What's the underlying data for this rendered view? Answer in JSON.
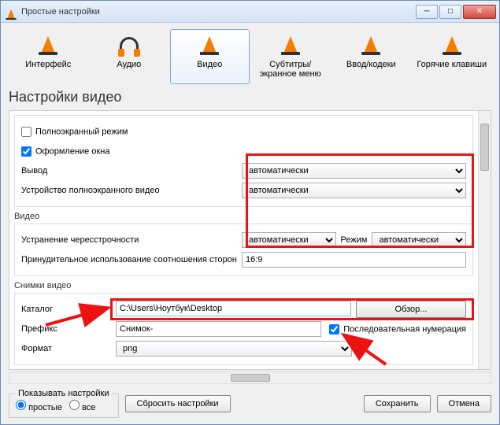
{
  "window": {
    "title": "Простые настройки"
  },
  "tabs": [
    {
      "label": "Интерфейс"
    },
    {
      "label": "Аудио"
    },
    {
      "label": "Видео"
    },
    {
      "label": "Субтитры/экранное меню"
    },
    {
      "label": "Ввод/кодеки"
    },
    {
      "label": "Горячие клавиши"
    }
  ],
  "heading": "Настройки видео",
  "general": {
    "fullscreen": {
      "label": "Полноэкранный режим",
      "checked": false
    },
    "decorations": {
      "label": "Оформление окна",
      "checked": true
    },
    "output": {
      "label": "Вывод",
      "value": "автоматически"
    },
    "fullscreen_device": {
      "label": "Устройство полноэкранного видео",
      "value": "автоматически"
    }
  },
  "video_section": {
    "title": "Видео",
    "deinterlace": {
      "label": "Устранение чересстрочности",
      "value": "автоматически"
    },
    "mode": {
      "label": "Режим",
      "value": "автоматически"
    },
    "aspect": {
      "label": "Принудительное использование соотношения сторон",
      "value": "16:9"
    }
  },
  "snapshots": {
    "title": "Снимки видео",
    "directory": {
      "label": "Каталог",
      "value": "C:\\Users\\Ноутбук\\Desktop",
      "browse": "Обзор..."
    },
    "prefix": {
      "label": "Префикс",
      "value": "Снимок-"
    },
    "sequential": {
      "label": "Последовательная нумерация",
      "checked": true
    },
    "format": {
      "label": "Формат",
      "value": "png"
    }
  },
  "footer": {
    "show_title": "Показывать настройки",
    "simple": "простые",
    "all": "все",
    "reset": "Сбросить настройки",
    "save": "Сохранить",
    "cancel": "Отмена"
  }
}
